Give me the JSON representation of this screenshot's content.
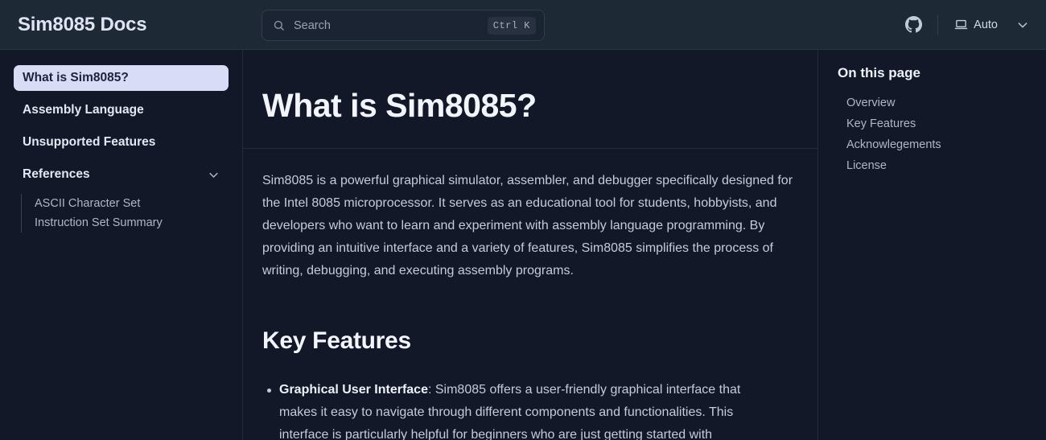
{
  "header": {
    "brand": "Sim8085 Docs",
    "search": {
      "placeholder": "Search",
      "shortcut": "Ctrl K",
      "icon": "search-icon"
    },
    "github": {
      "icon": "github-icon",
      "label": "GitHub"
    },
    "theme": {
      "icon": "laptop-icon",
      "label": "Auto",
      "chevron": "chevron-down-icon"
    }
  },
  "sidebar": {
    "items": [
      {
        "label": "What is Sim8085?",
        "active": true
      },
      {
        "label": "Assembly Language",
        "active": false
      },
      {
        "label": "Unsupported Features",
        "active": false
      },
      {
        "label": "References",
        "active": false,
        "expandable": true,
        "chevron": "chevron-down-icon"
      }
    ],
    "subitems": [
      {
        "label": "ASCII Character Set"
      },
      {
        "label": "Instruction Set Summary"
      }
    ]
  },
  "main": {
    "title": "What is Sim8085?",
    "intro": "Sim8085 is a powerful graphical simulator, assembler, and debugger specifically designed for the Intel 8085 microprocessor. It serves as an educational tool for students, hobbyists, and developers who want to learn and experiment with assembly language programming. By providing an intuitive interface and a variety of features, Sim8085 simplifies the process of writing, debugging, and executing assembly programs.",
    "section_heading": "Key Features",
    "features": [
      {
        "term": "Graphical User Interface",
        "separator": ": ",
        "description": "Sim8085 offers a user-friendly graphical interface that makes it easy to navigate through different components and functionalities. This interface is particularly helpful for beginners who are just getting started with"
      }
    ]
  },
  "toc": {
    "title": "On this page",
    "items": [
      {
        "label": "Overview"
      },
      {
        "label": "Key Features"
      },
      {
        "label": "Acknowlegements"
      },
      {
        "label": "License"
      }
    ]
  },
  "colors": {
    "header_bg": "#1e2936",
    "page_bg": "#121828",
    "active_nav_bg": "#d9dcf7",
    "active_nav_text": "#1e2338",
    "border": "#222c3a",
    "text_primary": "#f2f5fb",
    "text_body": "#c4ccdc",
    "text_muted": "#aeb7c7"
  }
}
